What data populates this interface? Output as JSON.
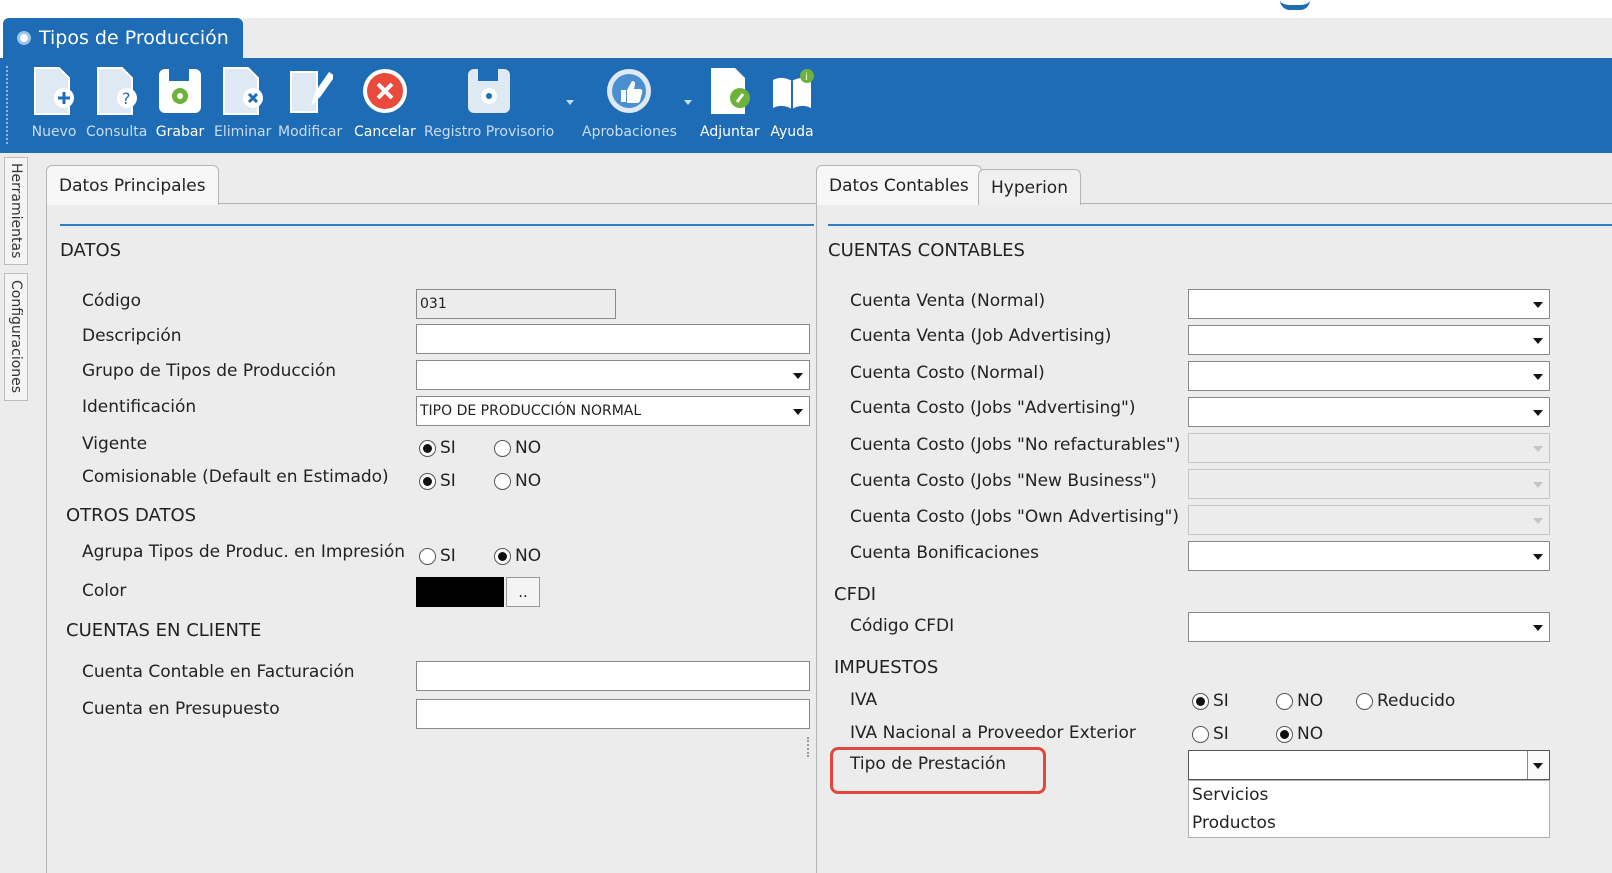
{
  "window": {
    "tab_title": "Tipos de Producción"
  },
  "toolbar": {
    "buttons": [
      {
        "id": "nuevo",
        "label": "Nuevo",
        "icon": "new-document-icon"
      },
      {
        "id": "consulta",
        "label": "Consulta",
        "icon": "query-document-icon"
      },
      {
        "id": "grabar",
        "label": "Grabar",
        "icon": "save-disk-icon"
      },
      {
        "id": "eliminar",
        "label": "Eliminar",
        "icon": "delete-document-icon"
      },
      {
        "id": "modificar",
        "label": "Modificar",
        "icon": "edit-document-icon"
      },
      {
        "id": "cancelar",
        "label": "Cancelar",
        "icon": "cancel-circle-icon"
      },
      {
        "id": "registro",
        "label": "Registro Provisorio",
        "icon": "provisional-save-icon"
      },
      {
        "id": "aprobaciones",
        "label": "Aprobaciones",
        "icon": "thumbs-up-icon"
      },
      {
        "id": "adjuntar",
        "label": "Adjuntar",
        "icon": "attach-document-icon"
      },
      {
        "id": "ayuda",
        "label": "Ayuda",
        "icon": "help-book-icon"
      }
    ]
  },
  "side_rail": {
    "tabs": [
      "Herramientas",
      "Configuraciones"
    ]
  },
  "left_panel": {
    "tab": "Datos Principales",
    "datos": {
      "heading": "DATOS",
      "codigo_label": "Código",
      "codigo_value": "031",
      "descripcion_label": "Descripción",
      "descripcion_value": "",
      "grupo_label": "Grupo de Tipos de Producción",
      "grupo_value": "",
      "identificacion_label": "Identificación",
      "identificacion_value": "TIPO DE PRODUCCIÓN NORMAL",
      "vigente_label": "Vigente",
      "comisionable_label": "Comisionable (Default en Estimado)"
    },
    "otros": {
      "heading": "OTROS DATOS",
      "agrupa_label": "Agrupa Tipos de Produc. en Impresión",
      "color_label": "Color",
      "color_value": "#000000",
      "color_button": ".."
    },
    "cuentas_cliente": {
      "heading": "CUENTAS EN CLIENTE",
      "facturacion_label": "Cuenta Contable en Facturación",
      "facturacion_value": "",
      "presupuesto_label": "Cuenta en Presupuesto",
      "presupuesto_value": ""
    }
  },
  "radio_text": {
    "si": "SI",
    "no": "NO",
    "reducido": "Reducido"
  },
  "right_panel": {
    "tabs": [
      "Datos Contables",
      "Hyperion"
    ],
    "cuentas": {
      "heading": "CUENTAS CONTABLES",
      "rows": [
        {
          "label": "Cuenta Venta (Normal)",
          "value": "",
          "disabled": false
        },
        {
          "label": "Cuenta Venta (Job Advertising)",
          "value": "",
          "disabled": false
        },
        {
          "label": "Cuenta Costo (Normal)",
          "value": "",
          "disabled": false
        },
        {
          "label": "Cuenta Costo (Jobs \"Advertising\")",
          "value": "",
          "disabled": false
        },
        {
          "label": "Cuenta Costo (Jobs \"No refacturables\")",
          "value": "",
          "disabled": true
        },
        {
          "label": "Cuenta Costo (Jobs \"New Business\")",
          "value": "",
          "disabled": true
        },
        {
          "label": "Cuenta Costo (Jobs \"Own Advertising\")",
          "value": "",
          "disabled": true
        },
        {
          "label": "Cuenta Bonificaciones",
          "value": "",
          "disabled": false
        }
      ]
    },
    "cfdi": {
      "heading": "CFDI",
      "codigo_label": "Código CFDI",
      "codigo_value": ""
    },
    "impuestos": {
      "heading": "IMPUESTOS",
      "iva_label": "IVA",
      "iva_nacional_label": "IVA Nacional a Proveedor Exterior",
      "tipo_prestacion_label": "Tipo de Prestación",
      "tipo_prestacion_value": "",
      "tipo_prestacion_options": [
        "Servicios",
        "Productos"
      ]
    }
  },
  "colors": {
    "toolbar_blue": "#1e6cb5",
    "highlight_red": "#e0473d",
    "panel_gray": "#ececec"
  }
}
